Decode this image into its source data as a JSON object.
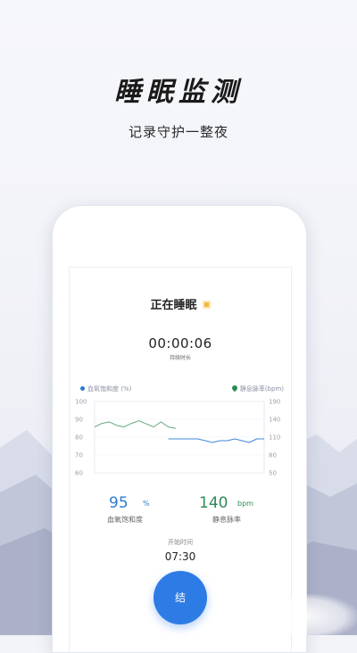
{
  "promo": {
    "headline": "睡眠监测",
    "subline": "记录守护一整夜"
  },
  "screen": {
    "status_title": "正在睡眠",
    "timer": "00:00:06",
    "timer_label": "持续时长",
    "legend_left": "血氧饱和度 (%)",
    "legend_right": "静息脉率(bpm)",
    "spo2_value": "95",
    "spo2_unit": "%",
    "spo2_label": "血氧饱和度",
    "pulse_value": "140",
    "pulse_unit": "bpm",
    "pulse_label": "静息脉率",
    "start_label": "开始时间",
    "start_time": "07:30",
    "end_button_label": "结"
  },
  "colors": {
    "spo2": "#2c7bd0",
    "pulse": "#2e8b57",
    "button": "#2d7ce6"
  },
  "chart_data": {
    "type": "line",
    "title": "",
    "left_axis": {
      "label": "血氧饱和度 (%)",
      "ticks": [
        100,
        90,
        80,
        70,
        60
      ],
      "ylim": [
        60,
        100
      ]
    },
    "right_axis": {
      "label": "静息脉率(bpm)",
      "ticks": [
        190,
        140,
        110,
        80,
        50
      ],
      "ylim": [
        50,
        190
      ]
    },
    "series": [
      {
        "name": "静息脉率(bpm)",
        "axis": "right",
        "x": [
          0,
          1,
          2,
          3,
          4,
          5,
          6,
          7,
          8,
          9,
          10,
          11
        ],
        "values": [
          140,
          147,
          150,
          143,
          140,
          147,
          152,
          146,
          140,
          150,
          140,
          137
        ]
      },
      {
        "name": "血氧饱和度 (%)",
        "axis": "left",
        "x": [
          10,
          11,
          12,
          13,
          14,
          15,
          16,
          17,
          18,
          19,
          20,
          21,
          22,
          23
        ],
        "values": [
          79,
          79,
          79,
          79,
          79,
          78,
          77,
          78,
          78,
          79,
          78,
          77,
          79,
          79
        ]
      }
    ],
    "grid": true
  }
}
